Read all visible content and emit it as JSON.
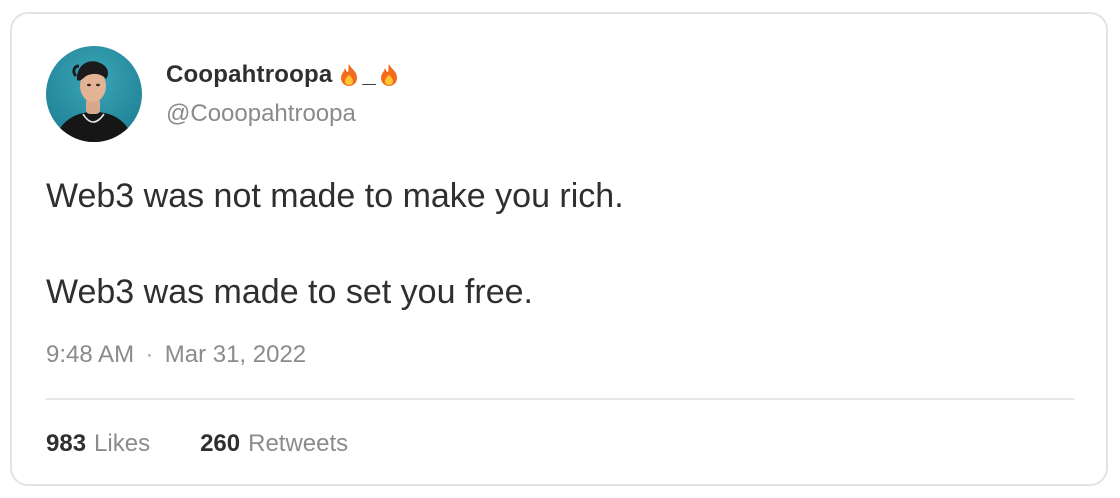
{
  "tweet": {
    "author": {
      "display_name": "Coopahtroopa",
      "name_separator": "_",
      "emoji_icon": "fire-emoji",
      "handle": "@Cooopahtroopa"
    },
    "text_lines": [
      "Web3 was not made to make you rich.",
      "Web3 was made to set you free."
    ],
    "time": "9:48 AM",
    "separator": "·",
    "date": "Mar 31, 2022",
    "stats": {
      "likes_count": "983",
      "likes_label": "Likes",
      "retweets_count": "260",
      "retweets_label": "Retweets"
    }
  },
  "colors": {
    "text_primary": "#2f2f2f",
    "text_secondary": "#8b8b8b",
    "border": "#e3e3e3",
    "avatar_background": "#2c8fa3"
  }
}
